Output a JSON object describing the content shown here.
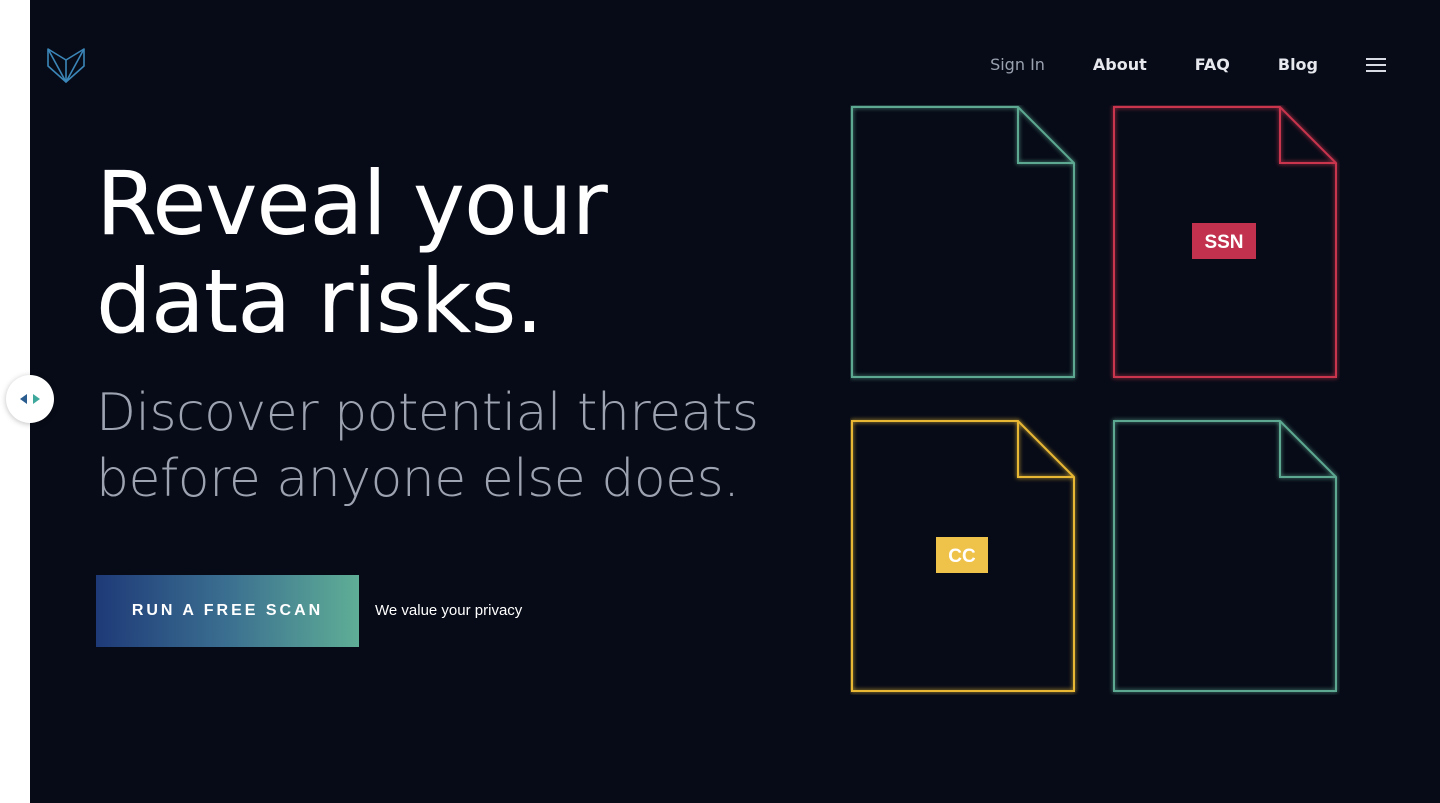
{
  "brand": {
    "logo_icon": "fox-logo-icon",
    "colors": {
      "background": "#070b17",
      "logo": "#3b86b8",
      "green": "#5ba890",
      "red": "#c8344e",
      "yellow": "#e8b834",
      "ssn_badge": "#c2324f",
      "cc_badge": "#efc24a"
    }
  },
  "nav": {
    "items": [
      {
        "label": "Sign In"
      },
      {
        "label": "About"
      },
      {
        "label": "FAQ"
      },
      {
        "label": "Blog"
      }
    ],
    "menu_icon": "hamburger-menu-icon"
  },
  "hero": {
    "headline": [
      "Reveal your",
      "data risks."
    ],
    "subhead": [
      "Discover potential threats",
      "before anyone else does."
    ],
    "cta_label": "RUN A FREE SCAN",
    "privacy_label": "We value your privacy"
  },
  "documents": [
    {
      "badge": "",
      "color": "green"
    },
    {
      "badge": "SSN",
      "color": "red"
    },
    {
      "badge": "CC",
      "color": "yellow"
    },
    {
      "badge": "",
      "color": "green"
    }
  ],
  "sidebar_toggle": {
    "icon": "left-right-arrows-icon"
  }
}
